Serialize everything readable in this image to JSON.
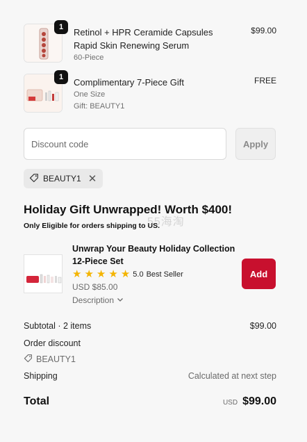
{
  "cart": {
    "items": [
      {
        "quantity": "1",
        "title": "Retinol + HPR Ceramide Capsules Rapid Skin Renewing Serum",
        "details": [
          "60-Piece"
        ],
        "price": "$99.00"
      },
      {
        "quantity": "1",
        "title": "Complimentary 7-Piece Gift",
        "details": [
          "One Size",
          "Gift: BEAUTY1"
        ],
        "price": "FREE"
      }
    ]
  },
  "discount": {
    "placeholder": "Discount code",
    "apply_label": "Apply",
    "applied_code": "BEAUTY1"
  },
  "promo": {
    "heading": "Holiday Gift Unwrapped! Worth $400!",
    "note": "Only Eligible for orders shipping to US.",
    "offer": {
      "title": "Unwrap Your Beauty Holiday Collection 12-Piece Set",
      "rating": "5.0",
      "stars": 5,
      "badge": "Best Seller",
      "price": "USD $85.00",
      "description_label": "Description",
      "add_label": "Add"
    }
  },
  "summary": {
    "subtotal_label": "Subtotal · 2 items",
    "subtotal_value": "$99.00",
    "order_discount_label": "Order discount",
    "discount_code": "BEAUTY1",
    "shipping_label": "Shipping",
    "shipping_value": "Calculated at next step",
    "total_label": "Total",
    "currency": "USD",
    "total_value": "$99.00"
  },
  "watermark": "55海淘",
  "colors": {
    "accent": "#c8102e",
    "star": "#f4b400"
  }
}
